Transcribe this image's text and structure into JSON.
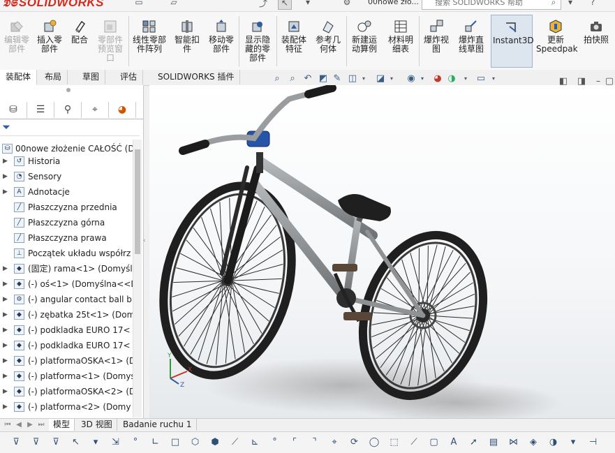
{
  "titlebar": {
    "logo": "SOLIDWORKS",
    "document_title": "00nowe zło...",
    "search_placeholder": "搜索 SOLIDWORKS 帮助"
  },
  "ribbon": {
    "buttons": [
      {
        "label": "编辑零部件",
        "enabled": false,
        "icon": "edit-component-icon"
      },
      {
        "label": "插入零部件",
        "enabled": true,
        "icon": "insert-component-icon"
      },
      {
        "label": "配合",
        "enabled": true,
        "icon": "mate-icon"
      },
      {
        "label": "零部件预览窗口",
        "enabled": false,
        "icon": "component-preview-icon"
      },
      {
        "label": "线性零部件阵列",
        "enabled": true,
        "icon": "linear-pattern-icon"
      },
      {
        "label": "智能扣件",
        "enabled": true,
        "icon": "smart-fastener-icon"
      },
      {
        "label": "移动零部件",
        "enabled": true,
        "icon": "move-component-icon"
      },
      {
        "label": "显示隐藏的零部件",
        "enabled": true,
        "icon": "show-hidden-icon"
      },
      {
        "label": "装配体特征",
        "enabled": true,
        "icon": "assembly-features-icon"
      },
      {
        "label": "参考几何体",
        "enabled": true,
        "icon": "reference-geometry-icon"
      },
      {
        "label": "新建运动算例",
        "enabled": true,
        "icon": "new-motion-study-icon"
      },
      {
        "label": "材料明细表",
        "enabled": true,
        "icon": "bom-icon"
      },
      {
        "label": "爆炸视图",
        "enabled": true,
        "icon": "exploded-view-icon"
      },
      {
        "label": "爆炸直线草图",
        "enabled": true,
        "icon": "explode-line-sketch-icon"
      },
      {
        "label": "Instant3D",
        "enabled": true,
        "active": true,
        "icon": "instant3d-icon"
      },
      {
        "label": "更新Speedpak",
        "enabled": true,
        "icon": "update-speedpak-icon"
      },
      {
        "label": "拍快照",
        "enabled": true,
        "icon": "snapshot-icon"
      }
    ]
  },
  "tabs": [
    "装配体",
    "布局",
    "草图",
    "评估",
    "SOLIDWORKS 插件"
  ],
  "active_tab": "装配体",
  "feature_tree": {
    "root": "00nowe złożenie CAŁOŚĆ  (D",
    "items": [
      {
        "label": "Historia",
        "icon": "history-icon"
      },
      {
        "label": "Sensory",
        "icon": "sensor-icon"
      },
      {
        "label": "Adnotacje",
        "icon": "annotation-icon"
      },
      {
        "label": "Płaszczyzna przednia",
        "icon": "plane-icon"
      },
      {
        "label": "Płaszczyzna górna",
        "icon": "plane-icon"
      },
      {
        "label": "Płaszczyzna prawa",
        "icon": "plane-icon"
      },
      {
        "label": "Początek układu współrz",
        "icon": "origin-icon"
      },
      {
        "label": "(固定) rama<1> (Domyśln",
        "icon": "part-icon"
      },
      {
        "label": "(-) oś<1> (Domyślna<<D",
        "icon": "part-icon"
      },
      {
        "label": "(-) angular contact ball b",
        "icon": "bearing-icon"
      },
      {
        "label": "(-) zębatka 25t<1> (Dom",
        "icon": "part-icon"
      },
      {
        "label": "(-) podkladka EURO 17<",
        "icon": "part-icon"
      },
      {
        "label": "(-) podkladka EURO 17<",
        "icon": "part-icon"
      },
      {
        "label": "(-) platformaOSKA<1> (D",
        "icon": "part-icon"
      },
      {
        "label": "(-) platforma<1> (Domys",
        "icon": "part-icon"
      },
      {
        "label": "(-) platformaOSKA<2> (D",
        "icon": "part-icon"
      },
      {
        "label": "(-) platforma<2> (Domy",
        "icon": "part-icon"
      }
    ]
  },
  "bottom_tabs": [
    "模型",
    "3D 视图",
    "Badanie ruchu 1"
  ],
  "active_bottom_tab": "模型"
}
